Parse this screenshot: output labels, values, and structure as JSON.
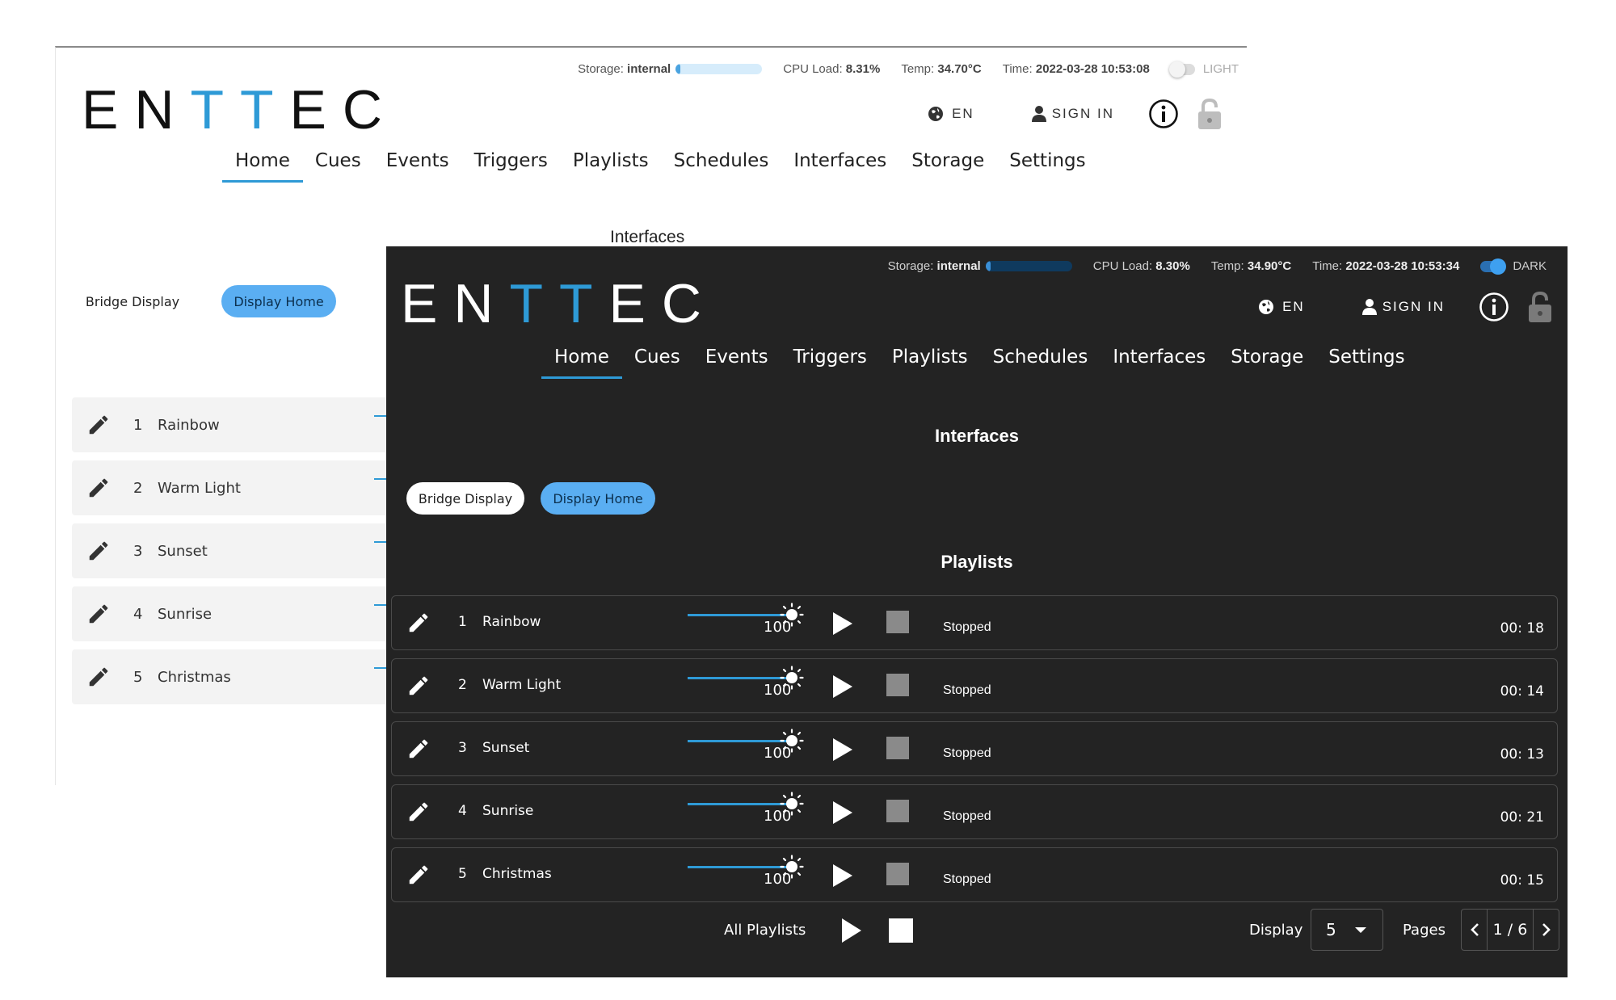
{
  "light": {
    "status": {
      "storage_label": "Storage:",
      "storage_value": "internal",
      "storage_fill": 0.05,
      "cpu_label": "CPU Load:",
      "cpu_value": "8.31%",
      "temp_label": "Temp:",
      "temp_value": "34.70°C",
      "time_label": "Time:",
      "time_value": "2022-03-28 10:53:08",
      "theme_label": "LIGHT"
    },
    "logo": {
      "before": "EN",
      "accent": "TT",
      "after": "EC"
    },
    "header": {
      "lang": "EN",
      "signin": "SIGN IN"
    },
    "nav": [
      "Home",
      "Cues",
      "Events",
      "Triggers",
      "Playlists",
      "Schedules",
      "Interfaces",
      "Storage",
      "Settings"
    ],
    "interfaces_heading": "Interfaces",
    "pills": {
      "bridge": "Bridge Display",
      "home": "Display Home"
    },
    "rows": [
      {
        "num": "1",
        "name": "Rainbow"
      },
      {
        "num": "2",
        "name": "Warm Light"
      },
      {
        "num": "3",
        "name": "Sunset"
      },
      {
        "num": "4",
        "name": "Sunrise"
      },
      {
        "num": "5",
        "name": "Christmas"
      }
    ]
  },
  "dark": {
    "status": {
      "storage_label": "Storage:",
      "storage_value": "internal",
      "storage_fill": 0.05,
      "cpu_label": "CPU Load:",
      "cpu_value": "8.30%",
      "temp_label": "Temp:",
      "temp_value": "34.90°C",
      "time_label": "Time:",
      "time_value": "2022-03-28 10:53:34",
      "theme_label": "DARK"
    },
    "logo": {
      "before": "EN",
      "accent": "TT",
      "after": "EC"
    },
    "header": {
      "lang": "EN",
      "signin": "SIGN IN"
    },
    "nav": [
      "Home",
      "Cues",
      "Events",
      "Triggers",
      "Playlists",
      "Schedules",
      "Interfaces",
      "Storage",
      "Settings"
    ],
    "interfaces_heading": "Interfaces",
    "pills": {
      "bridge": "Bridge Display",
      "home": "Display Home"
    },
    "playlists_heading": "Playlists",
    "rows": [
      {
        "num": "1",
        "name": "Rainbow",
        "level": "100",
        "status": "Stopped",
        "duration": "00: 18"
      },
      {
        "num": "2",
        "name": "Warm Light",
        "level": "100",
        "status": "Stopped",
        "duration": "00: 14"
      },
      {
        "num": "3",
        "name": "Sunset",
        "level": "100",
        "status": "Stopped",
        "duration": "00: 13"
      },
      {
        "num": "4",
        "name": "Sunrise",
        "level": "100",
        "status": "Stopped",
        "duration": "00: 21"
      },
      {
        "num": "5",
        "name": "Christmas",
        "level": "100",
        "status": "Stopped",
        "duration": "00: 15"
      }
    ],
    "footer": {
      "all_label": "All Playlists",
      "display_label": "Display",
      "display_value": "5",
      "pages_label": "Pages",
      "page_value": "1 / 6"
    }
  },
  "colors": {
    "accent": "#2e9ad6",
    "pill_active": "#5aaef2",
    "dark_bg": "#232323"
  },
  "icons": [
    "globe-icon",
    "person-icon",
    "info-icon",
    "lock-icon",
    "pencil-icon",
    "sun-icon",
    "play-icon",
    "stop-icon",
    "chevron-left-icon",
    "chevron-right-icon",
    "caret-down-icon"
  ]
}
